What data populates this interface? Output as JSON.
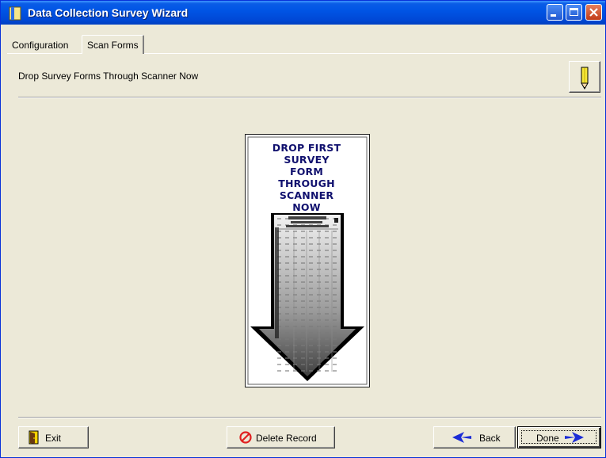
{
  "window": {
    "title": "Data Collection Survey Wizard"
  },
  "tabs": [
    {
      "label": "Configuration",
      "selected": false
    },
    {
      "label": "Scan Forms",
      "selected": true
    }
  ],
  "panel": {
    "instruction": "Drop Survey Forms Through Scanner Now",
    "edit_icon": "pencil-icon"
  },
  "scan_image": {
    "lines": [
      "DROP FIRST",
      "SURVEY",
      "FORM",
      "THROUGH",
      "SCANNER",
      "NOW"
    ],
    "text_color": "#10106e"
  },
  "footer": {
    "exit_label": "Exit",
    "exit_icon": "exit-door-icon",
    "delete_label": "Delete Record",
    "delete_icon": "no-entry-icon",
    "back_label": "Back",
    "back_icon": "left-arrow-icon",
    "done_label": "Done",
    "done_icon": "right-arrow-icon"
  },
  "colors": {
    "titlebar": "#0055e5",
    "background": "#ece9d8",
    "delete_icon": "#e02020",
    "arrow_blue": "#1b2cd6"
  }
}
